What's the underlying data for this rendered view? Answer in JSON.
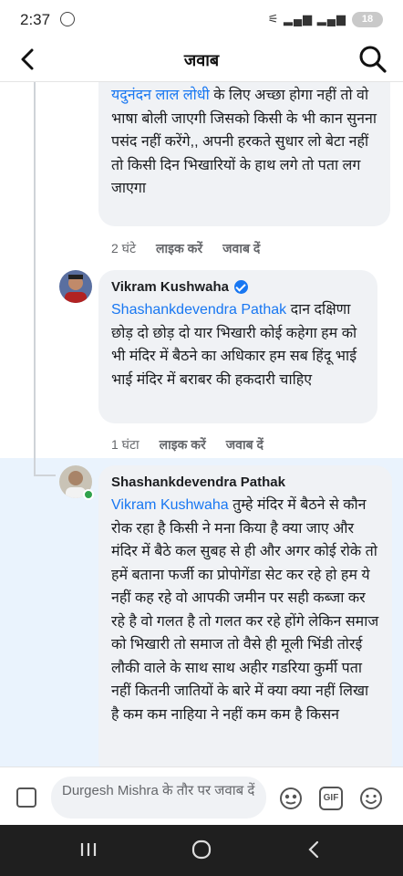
{
  "status_bar": {
    "time": "2:37",
    "battery": "18"
  },
  "header": {
    "title": "जवाब"
  },
  "comments": [
    {
      "text_mention": "यदुनंदन लाल लोधी",
      "text": " के लिए अच्छा होगा नहीं तो वो भाषा बोली जाएगी जिसको किसी के भी कान सुनना पसंद नहीं करेंगे,, अपनी हरकते सुधार लो बेटा नहीं तो किसी दिन भिखारियों के हाथ लगे तो पता लग जाएगा",
      "time": "2 घंटे",
      "like": "लाइक करें",
      "reply": "जवाब दें"
    },
    {
      "author": "Vikram Kushwaha",
      "verified": true,
      "text_mention": "Shashankdevendra Pathak",
      "text": " दान दक्षिणा छोड़ दो छोड़ दो यार भिखारी कोई कहेगा हम को भी मंदिर में बैठने का अधिकार  हम सब हिंदू भाई भाई मंदिर में बराबर की हकदारी चाहिए",
      "time": "1 घंटा",
      "like": "लाइक करें",
      "reply": "जवाब दें"
    },
    {
      "author": "Shashankdevendra Pathak",
      "text_mention": "Vikram Kushwaha",
      "text": " तुम्हे मंदिर में बैठने से कौन रोक रहा है किसी ने मना किया है क्या जाए और मंदिर में बैठे कल सुबह से ही और अगर कोई रोके तो हमें बताना फर्जी का प्रोपोगेंडा सेट कर रहे हो हम ये नहीं कह रहे वो आपकी जमीन पर सही कब्जा कर रहे है वो गलत है तो गलत कर रहे होंगे लेकिन समाज को भिखारी तो समाज तो वैसे ही मूली भिंडी तोरई लौकी वाले के साथ साथ अहीर गडरिया कुर्मी पता नहीं कितनी जातियों के बारे में क्या क्या नहीं लिखा है कम कम नाहिया ने नहीं कम कम है किसन"
    }
  ],
  "composer": {
    "placeholder": "Durgesh Mishra के तौर पर जवाब दें",
    "gif": "GIF"
  },
  "colors": {
    "link": "#1877f2",
    "highlight": "#eaf3fd",
    "bubble": "#f0f2f5"
  }
}
